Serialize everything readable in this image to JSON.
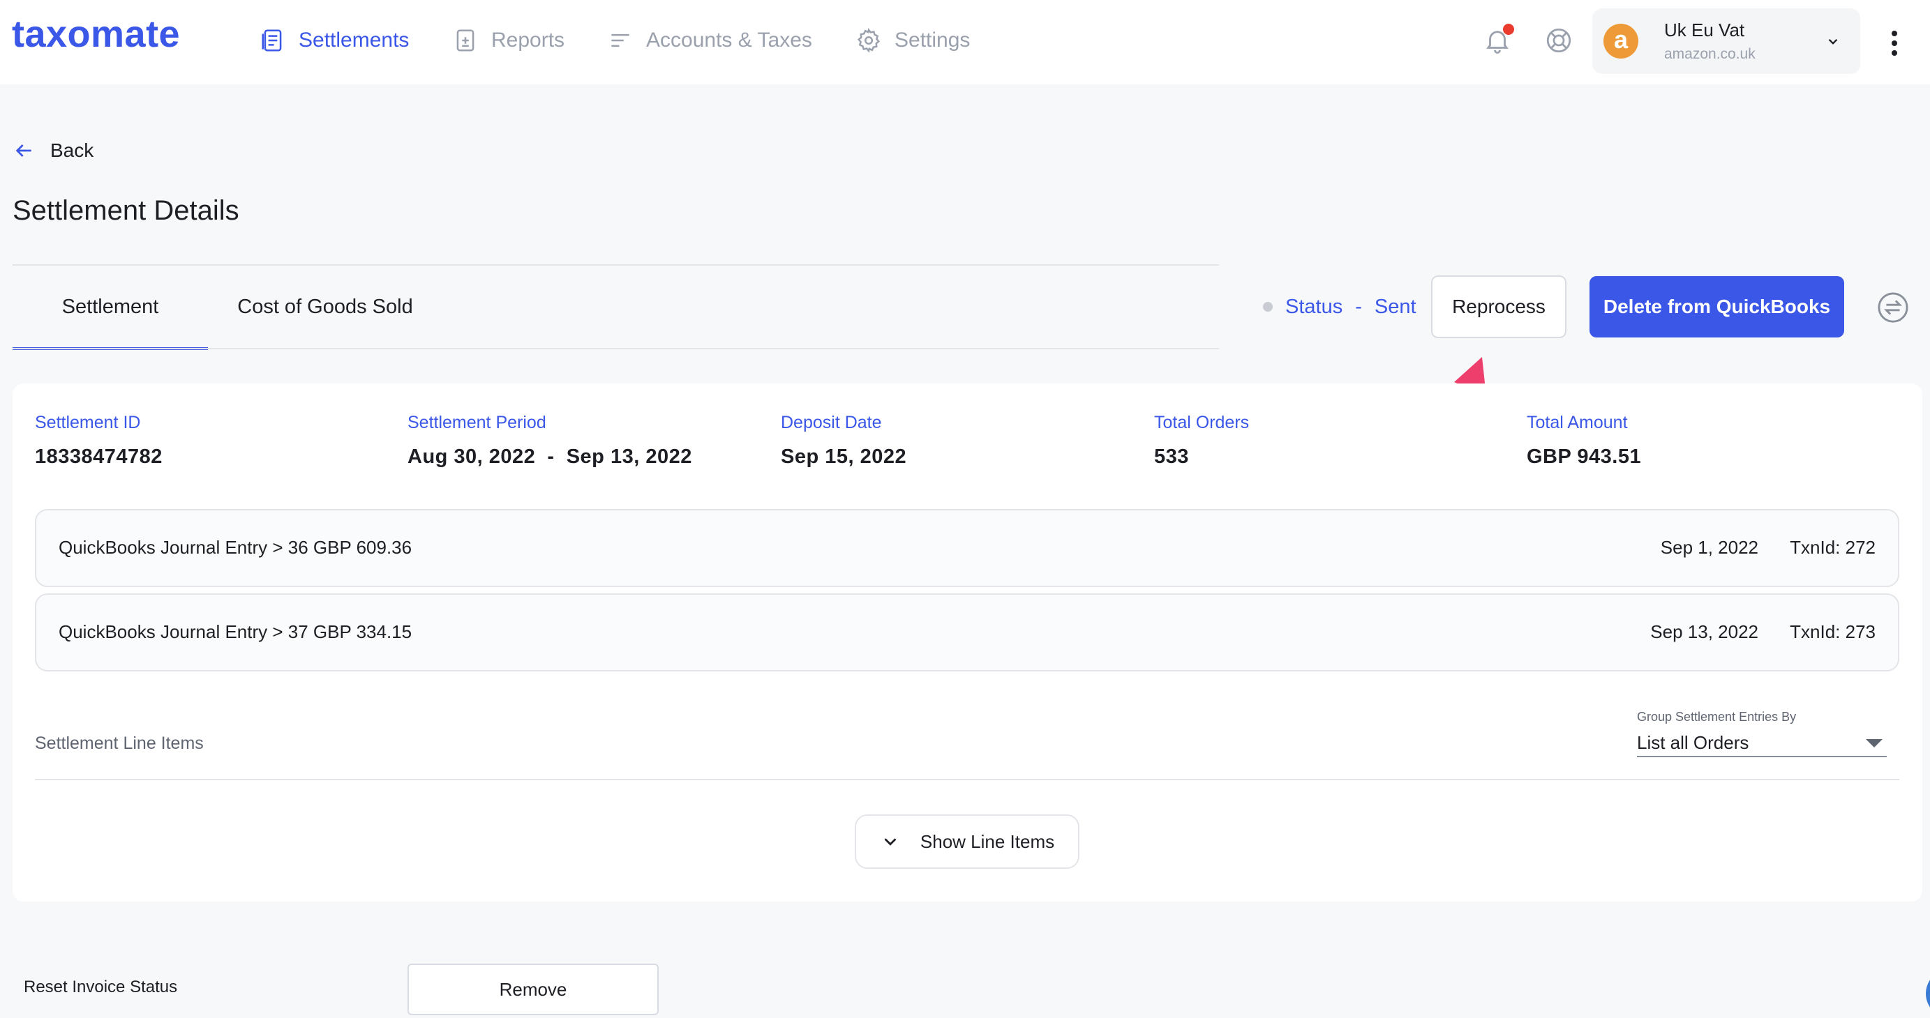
{
  "app": {
    "logo": "taxomate"
  },
  "nav": {
    "items": [
      {
        "label": "Settlements",
        "icon": "settlements-icon",
        "active": true
      },
      {
        "label": "Reports",
        "icon": "reports-icon",
        "active": false
      },
      {
        "label": "Accounts & Taxes",
        "icon": "accounts-icon",
        "active": false
      },
      {
        "label": "Settings",
        "icon": "gear-icon",
        "active": false
      }
    ]
  },
  "header": {
    "notification_icon": "bell-icon",
    "help_icon": "lifebuoy-icon",
    "account": {
      "avatar_letter": "a",
      "name": "Uk Eu Vat",
      "marketplace": "amazon.co.uk"
    },
    "menu_icon": "kebab-icon"
  },
  "page": {
    "back_label": "Back",
    "title": "Settlement Details"
  },
  "tabs": [
    {
      "label": "Settlement",
      "active": true
    },
    {
      "label": "Cost of Goods Sold",
      "active": false
    }
  ],
  "status": {
    "label": "Status",
    "separator": "-",
    "value": "Sent"
  },
  "actions": {
    "reprocess": "Reprocess",
    "delete": "Delete from QuickBooks",
    "sync_icon": "swap-icon"
  },
  "settlement": {
    "stats": [
      {
        "label": "Settlement ID",
        "value": "18338474782"
      },
      {
        "label": "Settlement Period",
        "value": "Aug 30, 2022  -  Sep 13, 2022"
      },
      {
        "label": "Deposit Date",
        "value": "Sep 15, 2022"
      },
      {
        "label": "Total Orders",
        "value": "533"
      },
      {
        "label": "Total Amount",
        "value": "GBP 943.51"
      }
    ],
    "journal_entries": [
      {
        "title": "QuickBooks Journal Entry > 36 GBP 609.36",
        "date": "Sep 1, 2022",
        "txn": "TxnId: 272"
      },
      {
        "title": "QuickBooks Journal Entry > 37 GBP 334.15",
        "date": "Sep 13, 2022",
        "txn": "TxnId: 273"
      }
    ],
    "line_items_label": "Settlement Line Items",
    "group_by": {
      "label": "Group Settlement Entries By",
      "value": "List all Orders"
    },
    "show_items": "Show Line Items"
  },
  "reset": {
    "label": "Reset Invoice Status",
    "button": "Remove"
  },
  "colors": {
    "accent": "#3a57e8",
    "annotation_arrow": "#ee3e6b",
    "avatar": "#ef9a38",
    "notification": "#e93b2e"
  }
}
